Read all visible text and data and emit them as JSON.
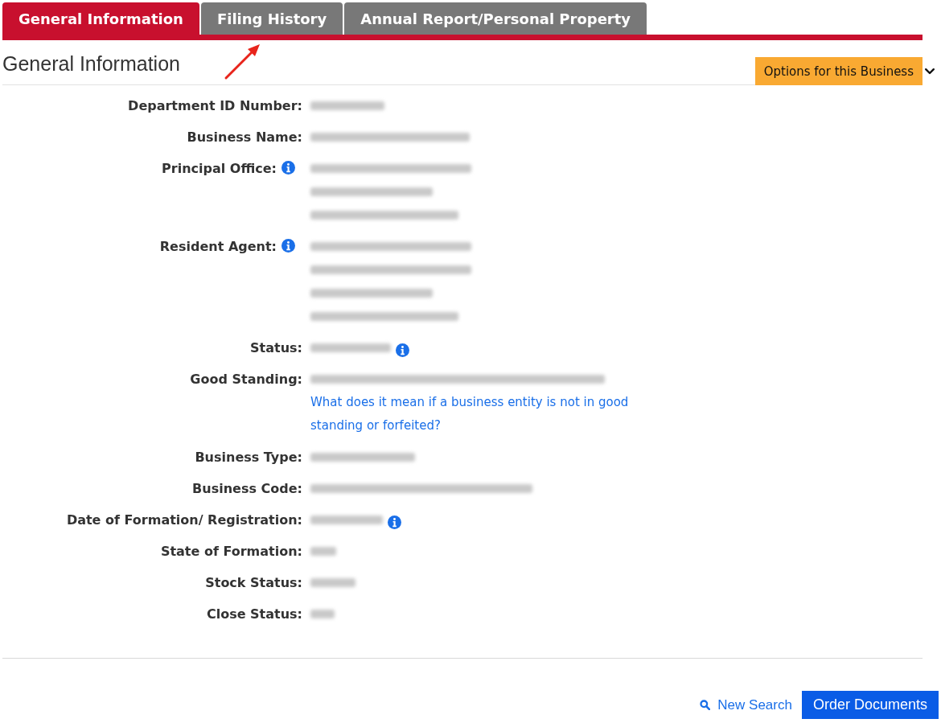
{
  "tabs": [
    {
      "label": "General Information",
      "selected": true
    },
    {
      "label": "Filing History",
      "selected": false
    },
    {
      "label": "Annual Report/Personal Property",
      "selected": false
    }
  ],
  "heading": "General Information",
  "options_button": {
    "label": "Options for this Business"
  },
  "fields": [
    {
      "label": "Department ID Number:",
      "label_info": false,
      "value_info": false,
      "lines": [
        {
          "kind": "redacted"
        }
      ]
    },
    {
      "label": "Business Name:",
      "label_info": false,
      "value_info": false,
      "lines": [
        {
          "kind": "redacted"
        }
      ]
    },
    {
      "label": "Principal Office:",
      "label_info": true,
      "value_info": false,
      "lines": [
        {
          "kind": "redacted"
        },
        {
          "kind": "redacted"
        },
        {
          "kind": "redacted"
        }
      ]
    },
    {
      "label": "Resident Agent:",
      "label_info": true,
      "value_info": false,
      "lines": [
        {
          "kind": "redacted"
        },
        {
          "kind": "redacted"
        },
        {
          "kind": "redacted"
        },
        {
          "kind": "redacted"
        }
      ]
    },
    {
      "label": "Status:",
      "label_info": false,
      "value_info": true,
      "lines": [
        {
          "kind": "redacted"
        }
      ]
    },
    {
      "label": "Good Standing:",
      "label_info": false,
      "value_info": false,
      "lines": [
        {
          "kind": "redacted"
        },
        {
          "kind": "link",
          "text": "What does it mean if a business entity is not in good standing or forfeited?"
        }
      ]
    },
    {
      "label": "Business Type:",
      "label_info": false,
      "value_info": false,
      "lines": [
        {
          "kind": "redacted"
        }
      ]
    },
    {
      "label": "Business Code:",
      "label_info": false,
      "value_info": false,
      "lines": [
        {
          "kind": "redacted"
        }
      ]
    },
    {
      "label": "Date of Formation/ Registration:",
      "label_info": false,
      "value_info": true,
      "lines": [
        {
          "kind": "redacted"
        }
      ]
    },
    {
      "label": "State of Formation:",
      "label_info": false,
      "value_info": false,
      "lines": [
        {
          "kind": "redacted"
        }
      ]
    },
    {
      "label": "Stock Status:",
      "label_info": false,
      "value_info": false,
      "lines": [
        {
          "kind": "redacted"
        }
      ]
    },
    {
      "label": "Close Status:",
      "label_info": false,
      "value_info": false,
      "lines": [
        {
          "kind": "redacted"
        }
      ]
    }
  ],
  "actions": {
    "new_search": "New Search",
    "order_documents": "Order Documents"
  }
}
